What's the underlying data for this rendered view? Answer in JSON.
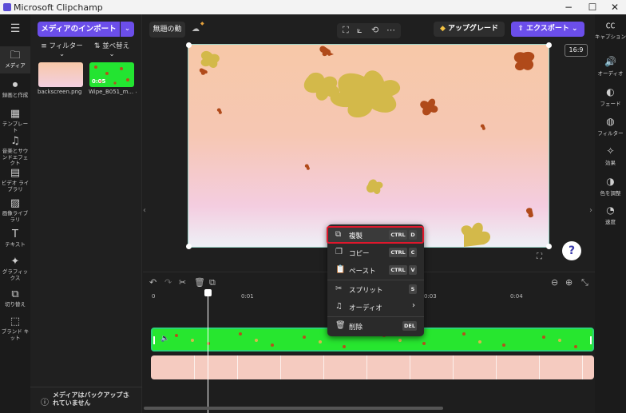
{
  "window": {
    "title": "Microsoft Clipchamp",
    "min": "−",
    "max": "☐",
    "close": "✕"
  },
  "left_rail": {
    "menu_icon": "☰",
    "items": [
      {
        "label": "メディア",
        "icon": "🗀"
      },
      {
        "label": "録画と作成",
        "icon": "⏺"
      },
      {
        "label": "テンプレート",
        "icon": "▦"
      },
      {
        "label": "音楽とサウンドエフェクト",
        "icon": "♫"
      },
      {
        "label": "ビデオ ライブラリ",
        "icon": "▤"
      },
      {
        "label": "画像ライブラリ",
        "icon": "▨"
      },
      {
        "label": "テキスト",
        "icon": "T"
      },
      {
        "label": "グラフィックス",
        "icon": "✦"
      },
      {
        "label": "切り替え",
        "icon": "⧉"
      },
      {
        "label": "ブランド キット",
        "icon": "⬚"
      }
    ]
  },
  "media_panel": {
    "import_button": "メディアのインポート",
    "filter_label": "フィルター",
    "sort_label": "並べ替え",
    "assets": [
      {
        "name": "backscreen.png",
        "check": "✓"
      },
      {
        "name": "Wipe_B051_m...",
        "duration": "0:05",
        "check": "✓"
      }
    ],
    "backup_notice": "メディアはバックアップされていません"
  },
  "top_bar": {
    "project_title": "無題の動",
    "cloud_icon": "cloud-off-icon",
    "toolbar_icons": [
      "⛶",
      "⟀",
      "⟲",
      "⋯"
    ],
    "upgrade_button": "アップグレード",
    "export_button": "エクスポート",
    "aspect_ratio": "16:9"
  },
  "right_rail": {
    "items": [
      {
        "label": "キャプション",
        "icon": "㏄"
      },
      {
        "label": "オーディオ",
        "icon": "🔊"
      },
      {
        "label": "フェード",
        "icon": "◐"
      },
      {
        "label": "フィルター",
        "icon": "◍"
      },
      {
        "label": "効果",
        "icon": "✧"
      },
      {
        "label": "色を調整",
        "icon": "◑"
      },
      {
        "label": "速度",
        "icon": "◔"
      }
    ]
  },
  "timeline": {
    "tools": [
      "↶",
      "↷",
      "✂",
      "🗑",
      "⧉"
    ],
    "zoom_out": "⊖",
    "zoom_in": "⊕",
    "fit": "⤡",
    "time_labels": [
      "0",
      "0:01",
      "0:03",
      "0:04"
    ]
  },
  "context_menu": {
    "items": [
      {
        "label": "複製",
        "icon": "⧉",
        "keys": [
          "CTRL",
          "D"
        ],
        "selected": true
      },
      {
        "label": "コピー",
        "icon": "❐",
        "keys": [
          "CTRL",
          "C"
        ]
      },
      {
        "label": "ペースト",
        "icon": "📋",
        "keys": [
          "CTRL",
          "V"
        ]
      },
      {
        "label": "スプリット",
        "icon": "✂",
        "keys": [
          "S"
        ]
      },
      {
        "label": "オーディオ",
        "icon": "♫",
        "submenu": "›"
      },
      {
        "label": "削除",
        "icon": "🗑",
        "keys": [
          "DEL"
        ]
      }
    ]
  },
  "help_button": "?"
}
